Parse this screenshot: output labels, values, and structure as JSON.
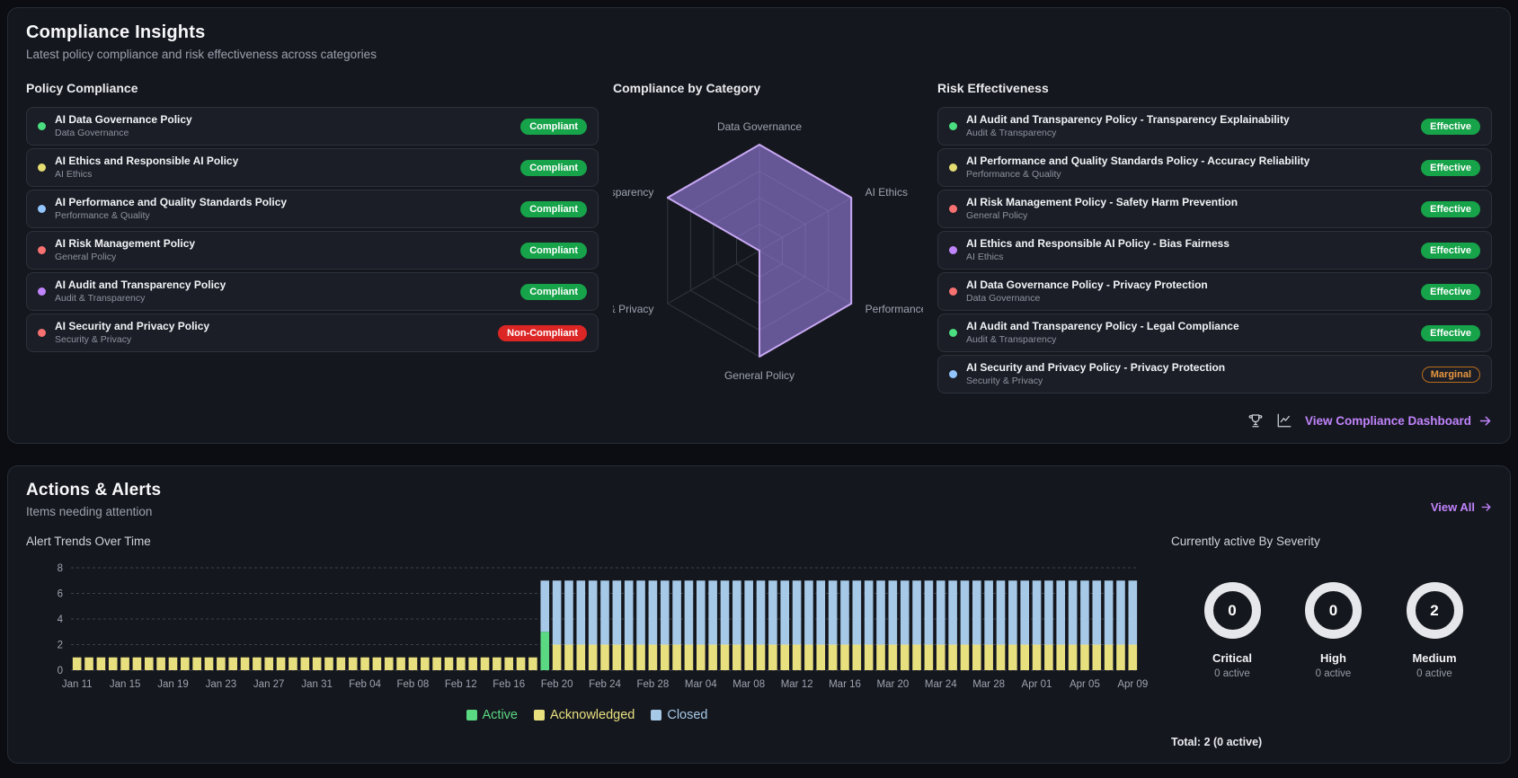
{
  "compliance_insights": {
    "title": "Compliance Insights",
    "subtitle": "Latest policy compliance and risk effectiveness across categories",
    "policy_compliance": {
      "heading": "Policy Compliance",
      "items": [
        {
          "name": "AI Data Governance Policy",
          "category": "Data Governance",
          "status": "Compliant",
          "dot_color": "#4ade80"
        },
        {
          "name": "AI Ethics and Responsible AI Policy",
          "category": "AI Ethics",
          "status": "Compliant",
          "dot_color": "#e5dc72"
        },
        {
          "name": "AI Performance and Quality Standards Policy",
          "category": "Performance & Quality",
          "status": "Compliant",
          "dot_color": "#93c5fd"
        },
        {
          "name": "AI Risk Management Policy",
          "category": "General Policy",
          "status": "Compliant",
          "dot_color": "#f87171"
        },
        {
          "name": "AI Audit and Transparency Policy",
          "category": "Audit & Transparency",
          "status": "Compliant",
          "dot_color": "#c084fc"
        },
        {
          "name": "AI Security and Privacy Policy",
          "category": "Security & Privacy",
          "status": "Non-Compliant",
          "dot_color": "#f87171"
        }
      ]
    },
    "risk_effectiveness": {
      "heading": "Risk Effectiveness",
      "items": [
        {
          "name": "AI Audit and Transparency Policy - Transparency Explainability",
          "category": "Audit & Transparency",
          "status": "Effective",
          "dot_color": "#4ade80"
        },
        {
          "name": "AI Performance and Quality Standards Policy - Accuracy Reliability",
          "category": "Performance & Quality",
          "status": "Effective",
          "dot_color": "#e5dc72"
        },
        {
          "name": "AI Risk Management Policy - Safety Harm Prevention",
          "category": "General Policy",
          "status": "Effective",
          "dot_color": "#f87171"
        },
        {
          "name": "AI Ethics and Responsible AI Policy - Bias Fairness",
          "category": "AI Ethics",
          "status": "Effective",
          "dot_color": "#c084fc"
        },
        {
          "name": "AI Data Governance Policy - Privacy Protection",
          "category": "Data Governance",
          "status": "Effective",
          "dot_color": "#f87171"
        },
        {
          "name": "AI Audit and Transparency Policy - Legal Compliance",
          "category": "Audit & Transparency",
          "status": "Effective",
          "dot_color": "#4ade80"
        },
        {
          "name": "AI Security and Privacy Policy - Privacy Protection",
          "category": "Security & Privacy",
          "status": "Marginal",
          "dot_color": "#93c5fd"
        }
      ]
    },
    "footer_link": "View Compliance Dashboard",
    "accent_color": "#c084fc"
  },
  "chart_data": [
    {
      "id": "compliance_by_category",
      "type": "radar",
      "title": "Compliance by Category",
      "categories": [
        "Data Governance",
        "AI Ethics",
        "Performance & Quality",
        "General Policy",
        "Security & Privacy",
        "Audit & Transparency"
      ],
      "values": [
        100,
        100,
        100,
        100,
        0,
        100
      ],
      "max": 100,
      "fill_color": "rgba(167,139,250,0.55)",
      "stroke_color": "#c7a8f2",
      "grid": true
    },
    {
      "id": "alert_trends",
      "type": "bar",
      "stacked": true,
      "title": "Alert Trends Over Time",
      "x_start": "Jan 11",
      "x_end": "Apr 09",
      "total_days": 89,
      "x_tick_labels": [
        "Jan 11",
        "Jan 15",
        "Jan 19",
        "Jan 23",
        "Jan 27",
        "Jan 31",
        "Feb 04",
        "Feb 08",
        "Feb 12",
        "Feb 16",
        "Feb 20",
        "Feb 24",
        "Feb 28",
        "Mar 04",
        "Mar 08",
        "Mar 12",
        "Mar 16",
        "Mar 20",
        "Mar 24",
        "Mar 28",
        "Apr 01",
        "Apr 05",
        "Apr 09"
      ],
      "x_tick_step_days": 4,
      "y_ticks": [
        0,
        2,
        4,
        6,
        8
      ],
      "ylim": [
        0,
        8
      ],
      "series_order": [
        "Active",
        "Acknowledged",
        "Closed"
      ],
      "colors": {
        "Active": "#5ad882",
        "Acknowledged": "#e8e07f",
        "Closed": "#a6c9e8"
      },
      "segments": [
        {
          "from": "Jan 11",
          "to": "Feb 18",
          "days": 39,
          "Active": 0,
          "Acknowledged": 1,
          "Closed": 0
        },
        {
          "from": "Feb 19",
          "to": "Feb 19",
          "days": 1,
          "Active": 3,
          "Acknowledged": 0,
          "Closed": 4
        },
        {
          "from": "Feb 20",
          "to": "Apr 09",
          "days": 49,
          "Active": 0,
          "Acknowledged": 2,
          "Closed": 5
        }
      ],
      "legend": [
        "Active",
        "Acknowledged",
        "Closed"
      ],
      "legend_position": "bottom-center",
      "grid": "dashed-horizontal"
    }
  ],
  "actions_alerts": {
    "title": "Actions & Alerts",
    "subtitle": "Items needing attention",
    "view_all": "View All",
    "severity_heading": "Currently active By Severity",
    "severity": [
      {
        "label": "Critical",
        "value": "0",
        "active": "0 active"
      },
      {
        "label": "High",
        "value": "0",
        "active": "0 active"
      },
      {
        "label": "Medium",
        "value": "2",
        "active": "0 active"
      }
    ],
    "total": "Total: 2 (0 active)",
    "donut_ring_color": "#e5e7eb"
  },
  "icons": {
    "trophy": "trophy-icon",
    "trend": "line-chart-icon",
    "arrow_right": "arrow-right-icon"
  }
}
